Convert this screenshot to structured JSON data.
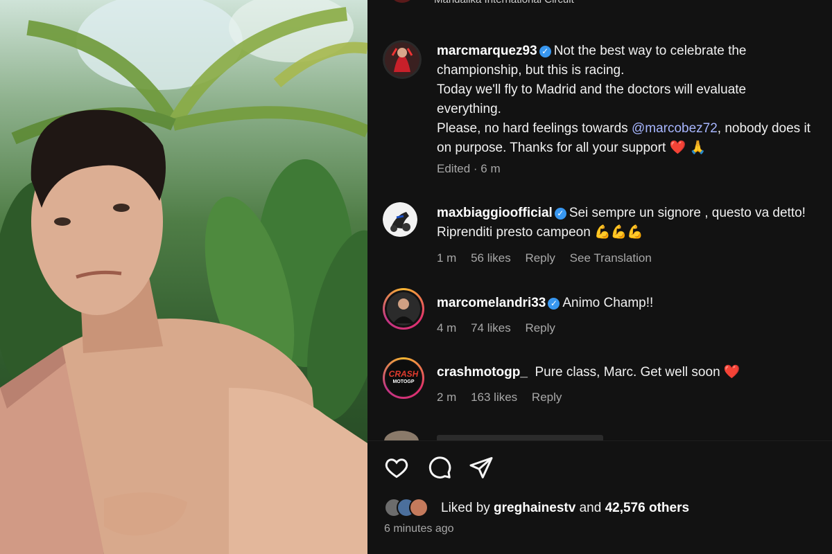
{
  "post": {
    "location": "Mandalika International Circuit",
    "photo_alt": "selfie with arm in sling"
  },
  "caption": {
    "username": "marcmarquez93",
    "line1": "Not the best way to celebrate the",
    "line2": "championship, but this is racing.",
    "line3": "Today we'll fly to Madrid and the doctors will evaluate",
    "line4": "everything.",
    "line5_pre": "Please, no hard feelings towards ",
    "line5_mention": "@marcobez72",
    "line5_post": ", nobody does it",
    "line6": "on purpose. Thanks for all your support",
    "emojis": "❤️ 🙏",
    "edited": "Edited · 6 m"
  },
  "comments": [
    {
      "username": "maxbiaggioofficial",
      "text1": "Sei sempre un signore , questo va detto!",
      "text2": "Riprenditi presto campeon",
      "emojis": "💪💪💪",
      "time": "1 m",
      "likes": "56 likes",
      "reply": "Reply",
      "translate": "See Translation"
    },
    {
      "username": "marcomelandri33",
      "text1": "Animo Champ!!",
      "time": "4 m",
      "likes": "74 likes",
      "reply": "Reply"
    },
    {
      "username": "crashmotogp_",
      "text1": "Pure class, Marc. Get well soon",
      "emojis": "❤️",
      "avatar_text1": "CRASH",
      "avatar_text2": "MOTOGP",
      "time": "2 m",
      "likes": "163 likes",
      "reply": "Reply"
    }
  ],
  "likes_bar": {
    "prefix": "Liked by ",
    "user": "greghainestv",
    "mid": " and ",
    "count": "42,576 others",
    "ago": "6 minutes ago"
  },
  "colors": {
    "panel_bg": "#121212",
    "verified": "#3897f0",
    "mention": "#a7b6ff",
    "meta": "#a8a8a8"
  },
  "icons": [
    "heart-icon",
    "comment-icon",
    "share-icon",
    "verified-icon"
  ]
}
